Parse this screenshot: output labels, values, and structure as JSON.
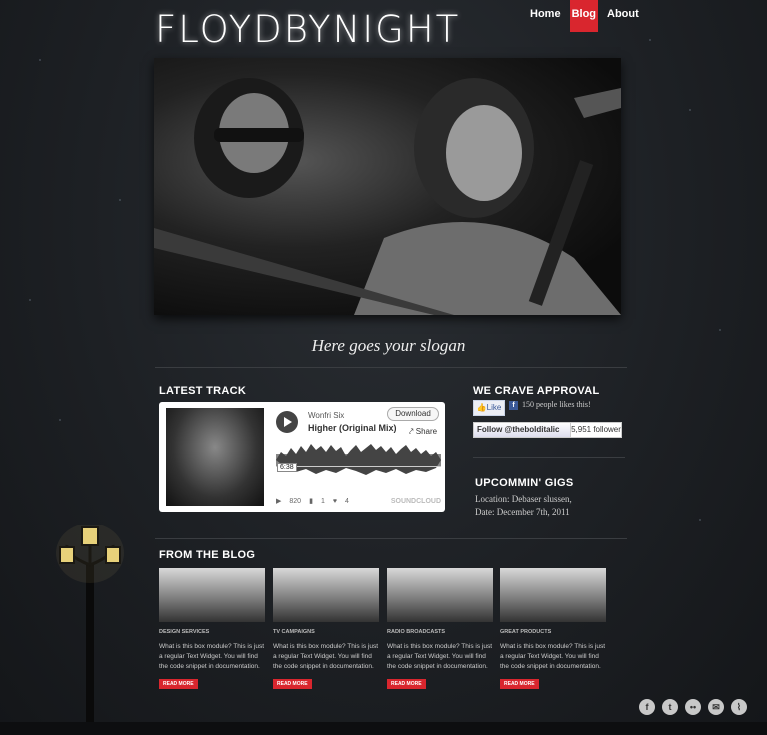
{
  "site": {
    "logo": "FLOYDBYNIGHT",
    "slogan": "Here goes your slogan"
  },
  "nav": {
    "items": [
      {
        "label": "Home"
      },
      {
        "label": "Blog"
      },
      {
        "label": "About"
      }
    ],
    "active": "Blog"
  },
  "latest_track": {
    "heading": "LATEST TRACK",
    "artist": "Wonfri Six",
    "title": "Higher (Original Mix)",
    "download_label": "Download",
    "share_label": "Share",
    "time": "6:38",
    "plays": "820",
    "comments": "1",
    "favorites": "4",
    "provider": "SOUNDCLOUD"
  },
  "approval": {
    "heading": "WE CRAVE APPROVAL",
    "like_label": "Like",
    "likes_text": "150 people likes this!",
    "follow_label": "Follow @thebolditalic",
    "followers": "5,951 follower"
  },
  "gigs": {
    "heading": "UPCOMMIN' GIGS",
    "location": "Location: Debaser slussen,",
    "date": "Date: December 7th, 2011"
  },
  "blog": {
    "heading": "FROM THE BLOG",
    "posts": [
      {
        "category": "DESIGN SERVICES",
        "text": "What is this box module? This is just a regular Text Widget. You will find the code snippet in documentation.",
        "more": "READ MORE"
      },
      {
        "category": "TV CAMPAIGNS",
        "text": "What is this box module? This is just a regular Text Widget. You will find the code snippet in documentation.",
        "more": "READ MORE"
      },
      {
        "category": "RADIO BROADCASTS",
        "text": "What is this box module? This is just a regular Text Widget. You will find the code snippet in documentation.",
        "more": "READ MORE"
      },
      {
        "category": "GREAT PRODUCTS",
        "text": "What is this box module? This is just a regular Text Widget. You will find the code snippet in documentation.",
        "more": "READ MORE"
      }
    ]
  },
  "social": [
    "facebook-icon",
    "twitter-icon",
    "flickr-icon",
    "email-icon",
    "rss-icon"
  ],
  "colors": {
    "accent": "#d9262e",
    "background": "#1d2024"
  }
}
